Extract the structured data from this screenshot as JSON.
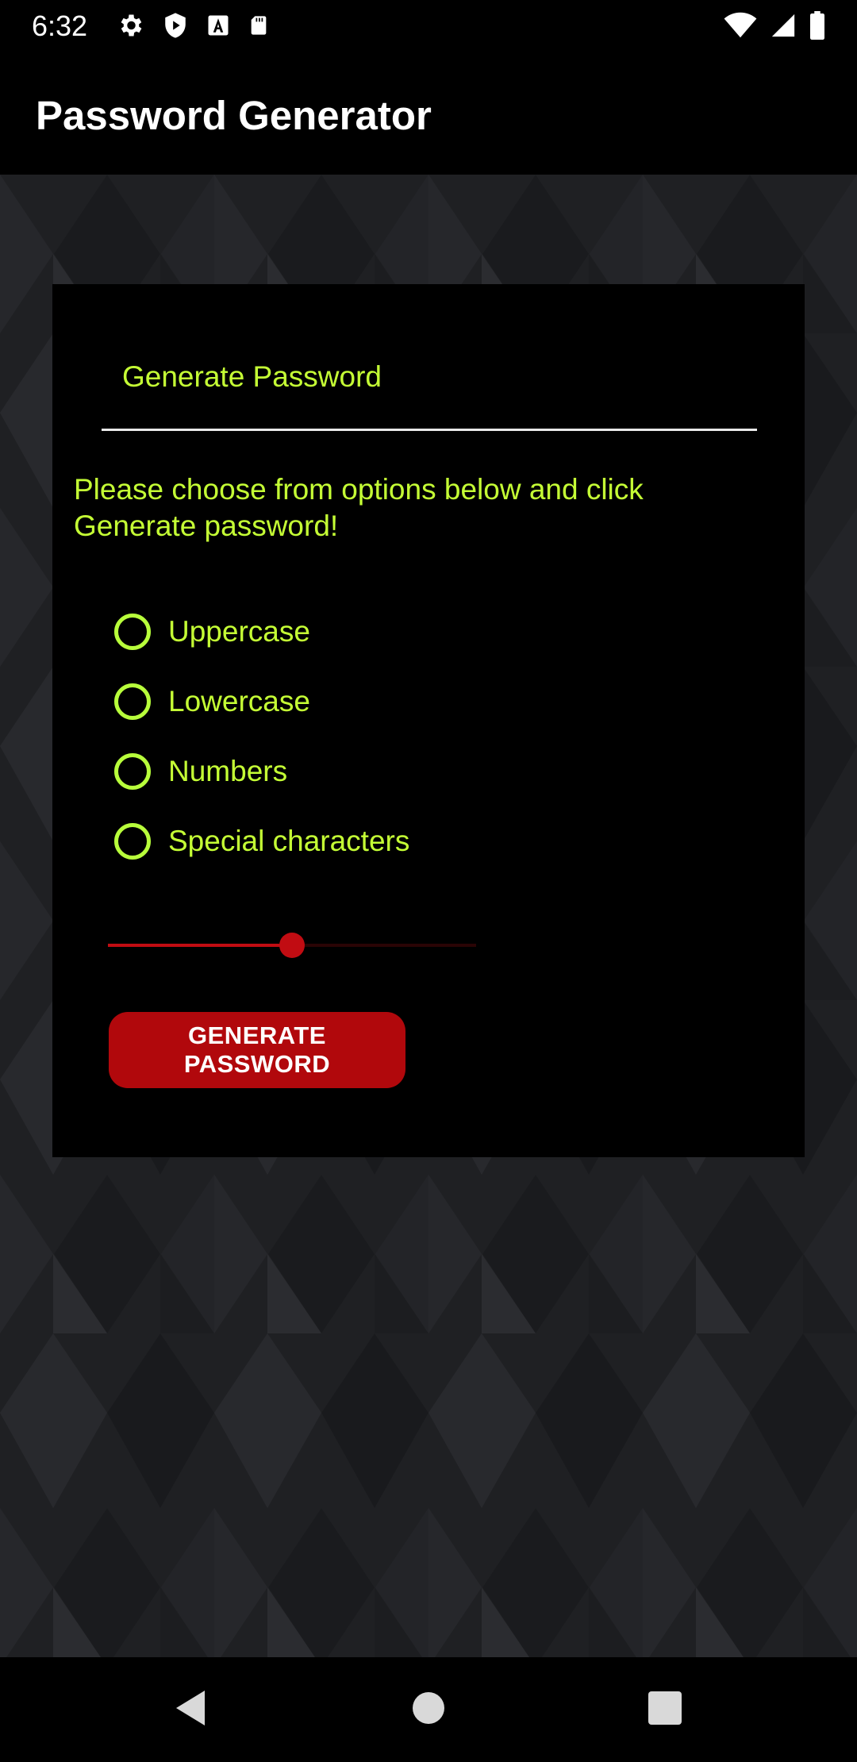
{
  "status_bar": {
    "time": "6:32",
    "left_icons": [
      "settings-icon",
      "shield-icon",
      "text-a-icon",
      "sd-card-icon"
    ],
    "right_icons": [
      "wifi-icon",
      "signal-icon",
      "battery-icon"
    ]
  },
  "app_bar": {
    "title": "Password Generator"
  },
  "card": {
    "title": "Generate Password",
    "instructions": "Please choose from options below and click Generate password!",
    "options": [
      {
        "label": "Uppercase",
        "checked": false
      },
      {
        "label": "Lowercase",
        "checked": false
      },
      {
        "label": "Numbers",
        "checked": false
      },
      {
        "label": "Special characters",
        "checked": false
      }
    ],
    "length_slider": {
      "value_fraction": 0.5
    },
    "generate_button": {
      "label": "GENERATE PASSWORD"
    }
  },
  "colors": {
    "accent_text": "#c5ff35",
    "radio_outline": "#b8ff3b",
    "button_red": "#b1080c",
    "slider_red": "#c10c12"
  },
  "nav_bar": {
    "icons": [
      "back-icon",
      "home-icon",
      "recents-icon"
    ]
  }
}
